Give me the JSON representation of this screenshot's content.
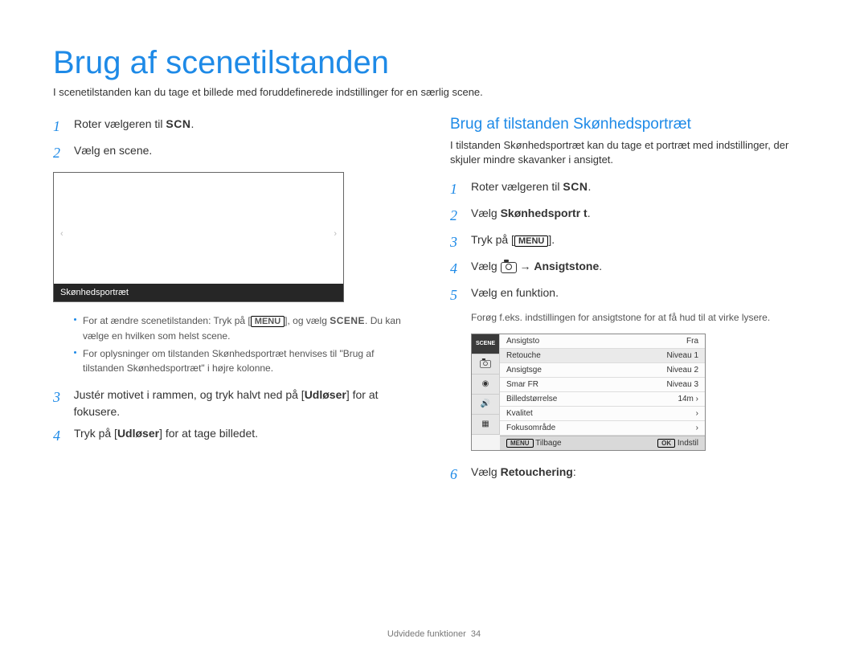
{
  "header": {
    "title": "Brug af scenetilstanden",
    "intro": "I scenetilstanden kan du tage et billede med foruddefinerede indstillinger for en særlig scene."
  },
  "left": {
    "steps": {
      "s1_pre": "Roter vælgeren til ",
      "s1_icon": "SCN",
      "s1_post": ".",
      "s2": "Vælg en scene.",
      "preview_label": "Skønhedsportræt",
      "bullet1_pre": "For at ændre scenetilstanden: Tryk på [",
      "bullet1_menu": "MENU",
      "bullet1_mid": "], og vælg ",
      "bullet1_scene": "SCENE",
      "bullet1_post": ". Du kan vælge en hvilken som helst scene.",
      "bullet2": "For oplysninger om tilstanden Skønhedsportræt henvises til \"Brug af tilstanden Skønhedsportræt\" i højre kolonne.",
      "s3_pre": "Justér motivet i rammen, og tryk halvt ned på [",
      "s3_bold": "Udløser",
      "s3_post": "] for at fokusere.",
      "s4_pre": "Tryk på [",
      "s4_bold": "Udløser",
      "s4_post": "] for at tage billedet."
    }
  },
  "right": {
    "subhead": "Brug af tilstanden Skønhedsportræt",
    "sub_desc": "I tilstanden Skønhedsportræt kan du tage et portræt med indstillinger, der skjuler mindre skavanker i ansigtet.",
    "steps": {
      "s1_pre": "Roter vælgeren til ",
      "s1_icon": "SCN",
      "s1_post": ".",
      "s2_pre": "Vælg ",
      "s2_bold": "Skønhedsportr t",
      "s2_post": ".",
      "s3_pre": "Tryk på [",
      "s3_menu": "MENU",
      "s3_post": "].",
      "s4_pre": "Vælg ",
      "s4_arrow": " → ",
      "s4_bold": "Ansigtstone",
      "s4_post": ".",
      "s5": "Vælg en funktion.",
      "s5_note": "Forøg f.eks. indstillingen for ansigtstone for at få hud til at virke lysere.",
      "s6_pre": "Vælg ",
      "s6_bold": "Retouchering",
      "s6_post": ":"
    },
    "cam_menu": {
      "rows": [
        {
          "l": "Ansigtsto",
          "r": "Fra"
        },
        {
          "l": "Retouche",
          "r": "Niveau 1"
        },
        {
          "l": "Ansigtsge",
          "r": "Niveau 2"
        },
        {
          "l": "Smar FR",
          "r": "Niveau 3"
        },
        {
          "l": "Billedstørrelse",
          "r": "14m ›"
        },
        {
          "l": "Kvalitet",
          "r": "›"
        },
        {
          "l": "Fokusområde",
          "r": "›"
        }
      ],
      "foot_left_icon": "MENU",
      "foot_left": "Tilbage",
      "foot_right_icon": "OK",
      "foot_right": "Indstil",
      "side_label": "SCENE"
    }
  },
  "footer": {
    "section": "Udvidede funktioner",
    "page": "34"
  }
}
